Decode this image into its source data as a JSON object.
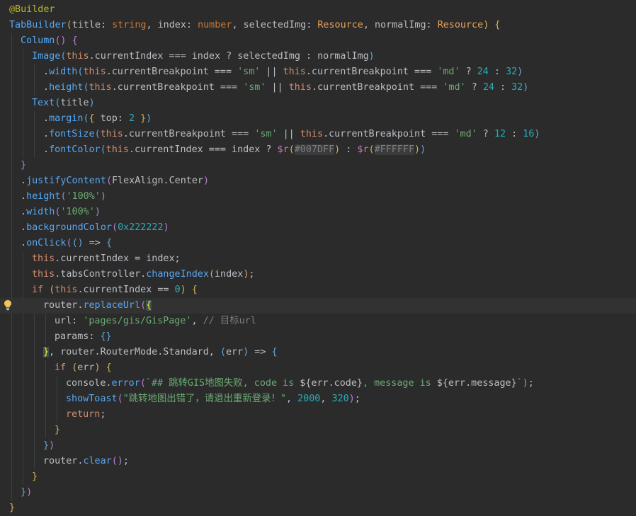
{
  "editor": {
    "lines": [
      {
        "indent": 0,
        "tokens": [
          [
            "anno",
            "@Builder"
          ]
        ]
      },
      {
        "indent": 0,
        "tokens": [
          [
            "fn",
            "TabBuilder"
          ],
          [
            "brk",
            "("
          ],
          [
            "plain",
            "title: "
          ],
          [
            "type",
            "string"
          ],
          [
            "plain",
            ", index: "
          ],
          [
            "type",
            "number"
          ],
          [
            "plain",
            ", selectedImg: "
          ],
          [
            "res",
            "Resource"
          ],
          [
            "plain",
            ", normalImg: "
          ],
          [
            "res",
            "Resource"
          ],
          [
            "brk",
            ")"
          ],
          [
            "plain",
            " "
          ],
          [
            "brk",
            "{"
          ]
        ]
      },
      {
        "indent": 1,
        "tokens": [
          [
            "fn",
            "Column"
          ],
          [
            "brk2",
            "()"
          ],
          [
            "plain",
            " "
          ],
          [
            "brk2",
            "{"
          ]
        ]
      },
      {
        "indent": 2,
        "tokens": [
          [
            "fn",
            "Image"
          ],
          [
            "brk3",
            "("
          ],
          [
            "kw",
            "this"
          ],
          [
            "plain",
            ".currentIndex === index ? selectedImg : normalImg"
          ],
          [
            "brk3",
            ")"
          ]
        ]
      },
      {
        "indent": 3,
        "tokens": [
          [
            "plain",
            "."
          ],
          [
            "fn",
            "width"
          ],
          [
            "brk3",
            "("
          ],
          [
            "kw",
            "this"
          ],
          [
            "plain",
            ".currentBreakpoint === "
          ],
          [
            "str",
            "'sm'"
          ],
          [
            "plain",
            " || "
          ],
          [
            "kw",
            "this"
          ],
          [
            "plain",
            ".currentBreakpoint === "
          ],
          [
            "str",
            "'md'"
          ],
          [
            "plain",
            " ? "
          ],
          [
            "num",
            "24"
          ],
          [
            "plain",
            " : "
          ],
          [
            "num",
            "32"
          ],
          [
            "brk3",
            ")"
          ]
        ]
      },
      {
        "indent": 3,
        "tokens": [
          [
            "plain",
            "."
          ],
          [
            "fn",
            "height"
          ],
          [
            "brk3",
            "("
          ],
          [
            "kw",
            "this"
          ],
          [
            "plain",
            ".currentBreakpoint === "
          ],
          [
            "str",
            "'sm'"
          ],
          [
            "plain",
            " || "
          ],
          [
            "kw",
            "this"
          ],
          [
            "plain",
            ".currentBreakpoint === "
          ],
          [
            "str",
            "'md'"
          ],
          [
            "plain",
            " ? "
          ],
          [
            "num",
            "24"
          ],
          [
            "plain",
            " : "
          ],
          [
            "num",
            "32"
          ],
          [
            "brk3",
            ")"
          ]
        ]
      },
      {
        "indent": 2,
        "tokens": [
          [
            "fn",
            "Text"
          ],
          [
            "brk3",
            "("
          ],
          [
            "plain",
            "title"
          ],
          [
            "brk3",
            ")"
          ]
        ]
      },
      {
        "indent": 3,
        "tokens": [
          [
            "plain",
            "."
          ],
          [
            "fn",
            "margin"
          ],
          [
            "brk3",
            "("
          ],
          [
            "brk",
            "{"
          ],
          [
            "plain",
            " top: "
          ],
          [
            "num",
            "2"
          ],
          [
            "plain",
            " "
          ],
          [
            "brk",
            "}"
          ],
          [
            "brk3",
            ")"
          ]
        ]
      },
      {
        "indent": 3,
        "tokens": [
          [
            "plain",
            "."
          ],
          [
            "fn",
            "fontSize"
          ],
          [
            "brk3",
            "("
          ],
          [
            "kw",
            "this"
          ],
          [
            "plain",
            ".currentBreakpoint === "
          ],
          [
            "str",
            "'sm'"
          ],
          [
            "plain",
            " || "
          ],
          [
            "kw",
            "this"
          ],
          [
            "plain",
            ".currentBreakpoint === "
          ],
          [
            "str",
            "'md'"
          ],
          [
            "plain",
            " ? "
          ],
          [
            "num",
            "12"
          ],
          [
            "plain",
            " : "
          ],
          [
            "num",
            "16"
          ],
          [
            "brk3",
            ")"
          ]
        ]
      },
      {
        "indent": 3,
        "tokens": [
          [
            "plain",
            "."
          ],
          [
            "fn",
            "fontColor"
          ],
          [
            "brk3",
            "("
          ],
          [
            "kw",
            "this"
          ],
          [
            "plain",
            ".currentIndex === index ? "
          ],
          [
            "prop",
            "$r"
          ],
          [
            "brk",
            "("
          ],
          [
            "hex",
            "#007DFF"
          ],
          [
            "brk",
            ")"
          ],
          [
            "plain",
            " : "
          ],
          [
            "prop",
            "$r"
          ],
          [
            "brk",
            "("
          ],
          [
            "hex",
            "#FFFFFF"
          ],
          [
            "brk",
            ")"
          ],
          [
            "brk3",
            ")"
          ]
        ]
      },
      {
        "indent": 1,
        "tokens": [
          [
            "brk2",
            "}"
          ]
        ]
      },
      {
        "indent": 1,
        "tokens": [
          [
            "plain",
            "."
          ],
          [
            "fn",
            "justifyContent"
          ],
          [
            "brk2",
            "("
          ],
          [
            "plain",
            "FlexAlign.Center"
          ],
          [
            "brk2",
            ")"
          ]
        ]
      },
      {
        "indent": 1,
        "tokens": [
          [
            "plain",
            "."
          ],
          [
            "fn",
            "height"
          ],
          [
            "brk2",
            "("
          ],
          [
            "str",
            "'100%'"
          ],
          [
            "brk2",
            ")"
          ]
        ]
      },
      {
        "indent": 1,
        "tokens": [
          [
            "plain",
            "."
          ],
          [
            "fn",
            "width"
          ],
          [
            "brk2",
            "("
          ],
          [
            "str",
            "'100%'"
          ],
          [
            "brk2",
            ")"
          ]
        ]
      },
      {
        "indent": 1,
        "tokens": [
          [
            "plain",
            "."
          ],
          [
            "fn",
            "backgroundColor"
          ],
          [
            "brk2",
            "("
          ],
          [
            "num",
            "0x222222"
          ],
          [
            "brk2",
            ")"
          ]
        ]
      },
      {
        "indent": 1,
        "tokens": [
          [
            "plain",
            "."
          ],
          [
            "fn",
            "onClick"
          ],
          [
            "brk2",
            "("
          ],
          [
            "brk3",
            "()"
          ],
          [
            "plain",
            " => "
          ],
          [
            "brk3",
            "{"
          ]
        ]
      },
      {
        "indent": 2,
        "tokens": [
          [
            "kw",
            "this"
          ],
          [
            "plain",
            ".currentIndex = index;"
          ]
        ]
      },
      {
        "indent": 2,
        "tokens": [
          [
            "kw",
            "this"
          ],
          [
            "plain",
            ".tabsController."
          ],
          [
            "fn",
            "changeIndex"
          ],
          [
            "brk",
            "("
          ],
          [
            "plain",
            "index"
          ],
          [
            "brk",
            ")"
          ],
          [
            "plain",
            ";"
          ]
        ]
      },
      {
        "indent": 2,
        "tokens": [
          [
            "kw",
            "if"
          ],
          [
            "plain",
            " "
          ],
          [
            "brk",
            "("
          ],
          [
            "kw",
            "this"
          ],
          [
            "plain",
            ".currentIndex == "
          ],
          [
            "num",
            "0"
          ],
          [
            "brk",
            ")"
          ],
          [
            "plain",
            " "
          ],
          [
            "brk",
            "{"
          ]
        ]
      },
      {
        "indent": 3,
        "current": true,
        "tokens": [
          [
            "plain",
            "router."
          ],
          [
            "fn",
            "replaceUrl"
          ],
          [
            "brk2",
            "("
          ],
          [
            "matchbrace",
            "{"
          ]
        ]
      },
      {
        "indent": 4,
        "tokens": [
          [
            "plain",
            "url: "
          ],
          [
            "str",
            "'pages/gis/GisPage'"
          ],
          [
            "plain",
            ", "
          ],
          [
            "cmt",
            "// 目标url"
          ]
        ]
      },
      {
        "indent": 4,
        "tokens": [
          [
            "plain",
            "params: "
          ],
          [
            "brk3",
            "{}"
          ]
        ]
      },
      {
        "indent": 3,
        "tokens": [
          [
            "matchbrace",
            "}"
          ],
          [
            "plain",
            ", router.RouterMode.Standard, "
          ],
          [
            "brk3",
            "("
          ],
          [
            "plain",
            "err"
          ],
          [
            "brk3",
            ")"
          ],
          [
            "plain",
            " => "
          ],
          [
            "brk3",
            "{"
          ]
        ]
      },
      {
        "indent": 4,
        "tokens": [
          [
            "kw",
            "if"
          ],
          [
            "plain",
            " "
          ],
          [
            "brk",
            "("
          ],
          [
            "plain",
            "err"
          ],
          [
            "brk",
            ")"
          ],
          [
            "plain",
            " "
          ],
          [
            "brk",
            "{"
          ]
        ]
      },
      {
        "indent": 5,
        "tokens": [
          [
            "plain",
            "console."
          ],
          [
            "fn",
            "error"
          ],
          [
            "brk2",
            "("
          ],
          [
            "str",
            "`## 跳转GIS地图失败, code is "
          ],
          [
            "plain",
            "${err.code}"
          ],
          [
            "str",
            ", message is "
          ],
          [
            "plain",
            "${err.message}"
          ],
          [
            "str",
            "`"
          ],
          [
            "brk2",
            ")"
          ],
          [
            "plain",
            ";"
          ]
        ]
      },
      {
        "indent": 5,
        "tokens": [
          [
            "fn",
            "showToast"
          ],
          [
            "brk2",
            "("
          ],
          [
            "str",
            "\"跳转地图出错了，请退出重新登录！\""
          ],
          [
            "plain",
            ", "
          ],
          [
            "num",
            "2000"
          ],
          [
            "plain",
            ", "
          ],
          [
            "num",
            "320"
          ],
          [
            "brk2",
            ")"
          ],
          [
            "plain",
            ";"
          ]
        ]
      },
      {
        "indent": 5,
        "tokens": [
          [
            "kw",
            "return"
          ],
          [
            "plain",
            ";"
          ]
        ]
      },
      {
        "indent": 4,
        "tokens": [
          [
            "brk",
            "}"
          ]
        ]
      },
      {
        "indent": 3,
        "tokens": [
          [
            "brk3",
            "}"
          ],
          [
            "brk2",
            ")"
          ]
        ]
      },
      {
        "indent": 3,
        "tokens": [
          [
            "plain",
            "router."
          ],
          [
            "fn",
            "clear"
          ],
          [
            "brk2",
            "()"
          ],
          [
            "plain",
            ";"
          ]
        ]
      },
      {
        "indent": 2,
        "tokens": [
          [
            "brk",
            "}"
          ]
        ]
      },
      {
        "indent": 1,
        "tokens": [
          [
            "brk3",
            "}"
          ],
          [
            "brk2",
            ")"
          ]
        ]
      },
      {
        "indent": 0,
        "tokens": [
          [
            "brk",
            "}"
          ]
        ]
      }
    ]
  },
  "gutter": {
    "intention_icon": "lightbulb-icon",
    "intention_line": 20
  },
  "colors": {
    "background": "#2b2b2b",
    "current_line": "#323232",
    "keyword": "#cf8e6d",
    "function": "#56a8f5",
    "string": "#6aab73",
    "number": "#2aacb8",
    "comment": "#7a7e85",
    "annotation": "#bbb529"
  }
}
